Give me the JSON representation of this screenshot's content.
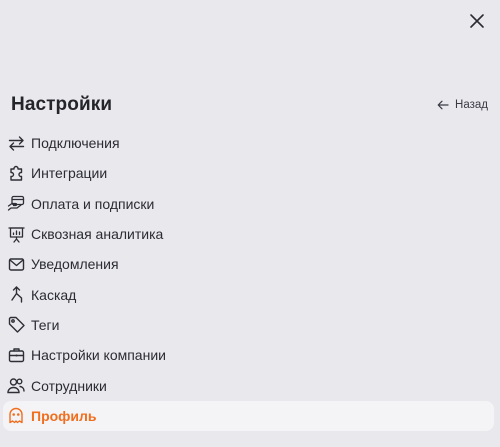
{
  "header": {
    "title": "Настройки",
    "back_label": "Назад"
  },
  "menu": {
    "items": [
      {
        "label": "Подключения",
        "icon": "arrows-swap-icon"
      },
      {
        "label": "Интеграции",
        "icon": "puzzle-icon"
      },
      {
        "label": "Оплата и подписки",
        "icon": "payment-icon"
      },
      {
        "label": "Сквозная аналитика",
        "icon": "presentation-chart-icon"
      },
      {
        "label": "Уведомления",
        "icon": "envelope-icon"
      },
      {
        "label": "Каскад",
        "icon": "cascade-icon"
      },
      {
        "label": "Теги",
        "icon": "tag-icon"
      },
      {
        "label": "Настройки компании",
        "icon": "briefcase-icon"
      },
      {
        "label": "Сотрудники",
        "icon": "users-icon"
      },
      {
        "label": "Профиль",
        "icon": "ghost-icon",
        "active": true
      }
    ]
  },
  "colors": {
    "background": "#e9e8ed",
    "accent": "#f06e1d",
    "active_background": "#f4f4f7",
    "text": "#2b2b33"
  }
}
